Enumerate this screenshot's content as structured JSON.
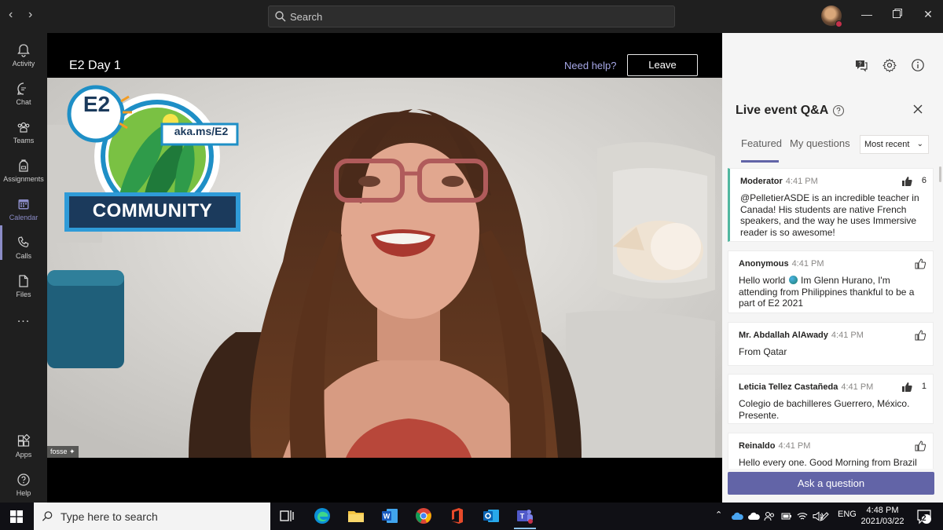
{
  "titlebar": {
    "search_placeholder": "Search"
  },
  "rail": {
    "items": [
      {
        "label": "Activity"
      },
      {
        "label": "Chat"
      },
      {
        "label": "Teams"
      },
      {
        "label": "Assignments"
      },
      {
        "label": "Calendar"
      },
      {
        "label": "Calls"
      },
      {
        "label": "Files"
      }
    ],
    "more": "...",
    "apps": "Apps",
    "help": "Help"
  },
  "event": {
    "title": "E2 Day 1",
    "need_help": "Need help?",
    "leave": "Leave",
    "speaker_tag": "fosse",
    "logo_top": "E2",
    "logo_link": "aka.ms/E2",
    "logo_banner": "COMMUNITY"
  },
  "qa": {
    "title": "Live event Q&A",
    "tabs": [
      {
        "label": "Featured"
      },
      {
        "label": "My questions"
      }
    ],
    "sort": "Most recent",
    "ask": "Ask a question",
    "items": [
      {
        "author": "Moderator",
        "time": "4:41 PM",
        "likes": "6",
        "body": "@PelletierASDE is an incredible teacher in Canada! His students are native French speakers, and the way he uses Immersive reader is so awesome!"
      },
      {
        "author": "Anonymous",
        "time": "4:41 PM",
        "likes": "",
        "body_pre": "Hello world",
        "body_post": "Im Glenn Hurano, I'm attending from Philippines thankful to be a part of E2 2021"
      },
      {
        "author": "Mr. Abdallah AlAwady",
        "time": "4:41 PM",
        "likes": "",
        "body": "From Qatar"
      },
      {
        "author": "Leticia Tellez Castañeda",
        "time": "4:41 PM",
        "likes": "1",
        "body": "Colegio de bachilleres Guerrero, México. Presente."
      },
      {
        "author": "Reinaldo",
        "time": "4:41 PM",
        "likes": "",
        "body": "Hello every one. Good Morning from Brazil"
      }
    ]
  },
  "taskbar": {
    "search_placeholder": "Type here to search",
    "lang": "ENG",
    "time": "4:48 PM",
    "date": "2021/03/22",
    "notifications": "2"
  },
  "colors": {
    "accent": "#6264a7",
    "moderator_bar": "#52b7a0",
    "rail_active": "#8b8cc7"
  }
}
